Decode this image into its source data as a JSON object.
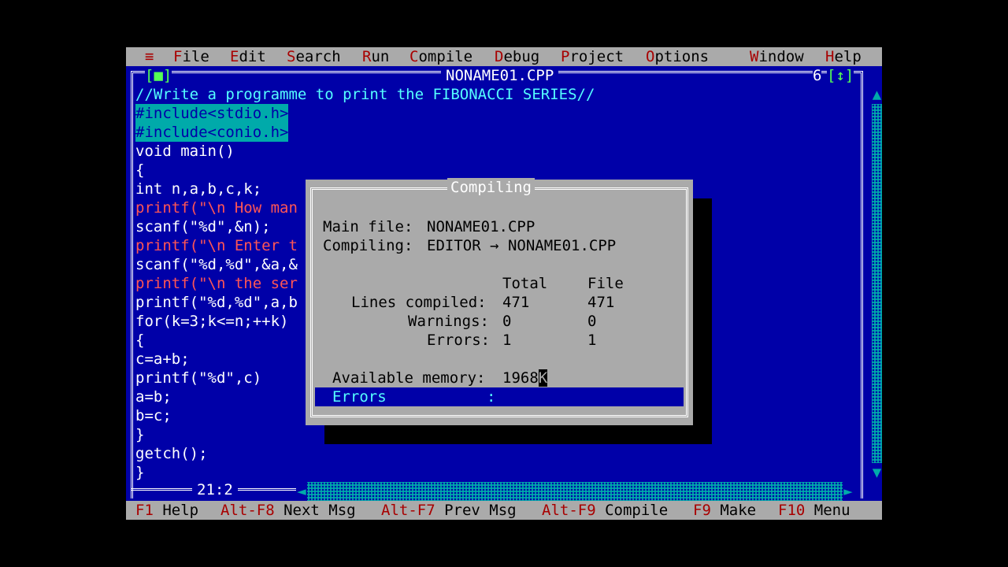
{
  "menu": {
    "system": "≡",
    "items": [
      {
        "hot": "F",
        "rest": "ile"
      },
      {
        "hot": "E",
        "rest": "dit"
      },
      {
        "hot": "S",
        "rest": "earch"
      },
      {
        "hot": "R",
        "rest": "un"
      },
      {
        "hot": "C",
        "rest": "ompile"
      },
      {
        "hot": "D",
        "rest": "ebug"
      },
      {
        "hot": "P",
        "rest": "roject"
      },
      {
        "hot": "O",
        "rest": "ptions"
      },
      {
        "hot": "W",
        "rest": "indow"
      },
      {
        "hot": "H",
        "rest": "elp"
      }
    ]
  },
  "editor": {
    "close_box": "[■]",
    "title": "NONAME01.CPP",
    "window_number": "6",
    "zoom_box": "[↕]",
    "cursor_position": "21:2",
    "lines": [
      "//Write a programme to print the FIBONACCI SERIES//",
      "#include<stdio.h>",
      "#include<conio.h>",
      "void main()",
      "{",
      "int n,a,b,c,k;",
      "printf(\"\\n How man",
      "scanf(\"%d\",&n);",
      "printf(\"\\n Enter t",
      "scanf(\"%d,%d\",&a,&",
      "printf(\"\\n the ser",
      "printf(\"%d,%d\",a,b",
      "for(k=3;k<=n;++k)",
      "{",
      "c=a+b;",
      "printf(\"%d\",c)",
      "a=b;",
      "b=c;",
      "}",
      "getch();",
      "}"
    ]
  },
  "dialog": {
    "title": "Compiling",
    "main_file_label": "Main file:",
    "main_file_value": "NONAME01.CPP",
    "compiling_label": "Compiling:",
    "compiling_value": "EDITOR → NONAME01.CPP",
    "col_total": "Total",
    "col_file": "File",
    "rows": [
      {
        "label": "Lines compiled:",
        "total": "471",
        "file": "471"
      },
      {
        "label": "Warnings:",
        "total": "0",
        "file": "0"
      },
      {
        "label": "Errors:",
        "total": "1",
        "file": "1"
      }
    ],
    "memory_label": "Available memory:",
    "memory_value": "1968",
    "memory_unit": "K",
    "status_label": "Errors",
    "status_sep": ":"
  },
  "statusbar": {
    "items": [
      {
        "key": "F1",
        "label": "Help"
      },
      {
        "key": "Alt-F8",
        "label": "Next Msg"
      },
      {
        "key": "Alt-F7",
        "label": "Prev Msg"
      },
      {
        "key": "Alt-F9",
        "label": "Compile"
      },
      {
        "key": "F9",
        "label": "Make"
      },
      {
        "key": "F10",
        "label": "Menu"
      }
    ]
  },
  "colors": {
    "background": "#0000a8",
    "menu": "#aaaaaa",
    "hotkey": "#a80000",
    "comment": "#55ffff",
    "string": "#ff5555"
  }
}
